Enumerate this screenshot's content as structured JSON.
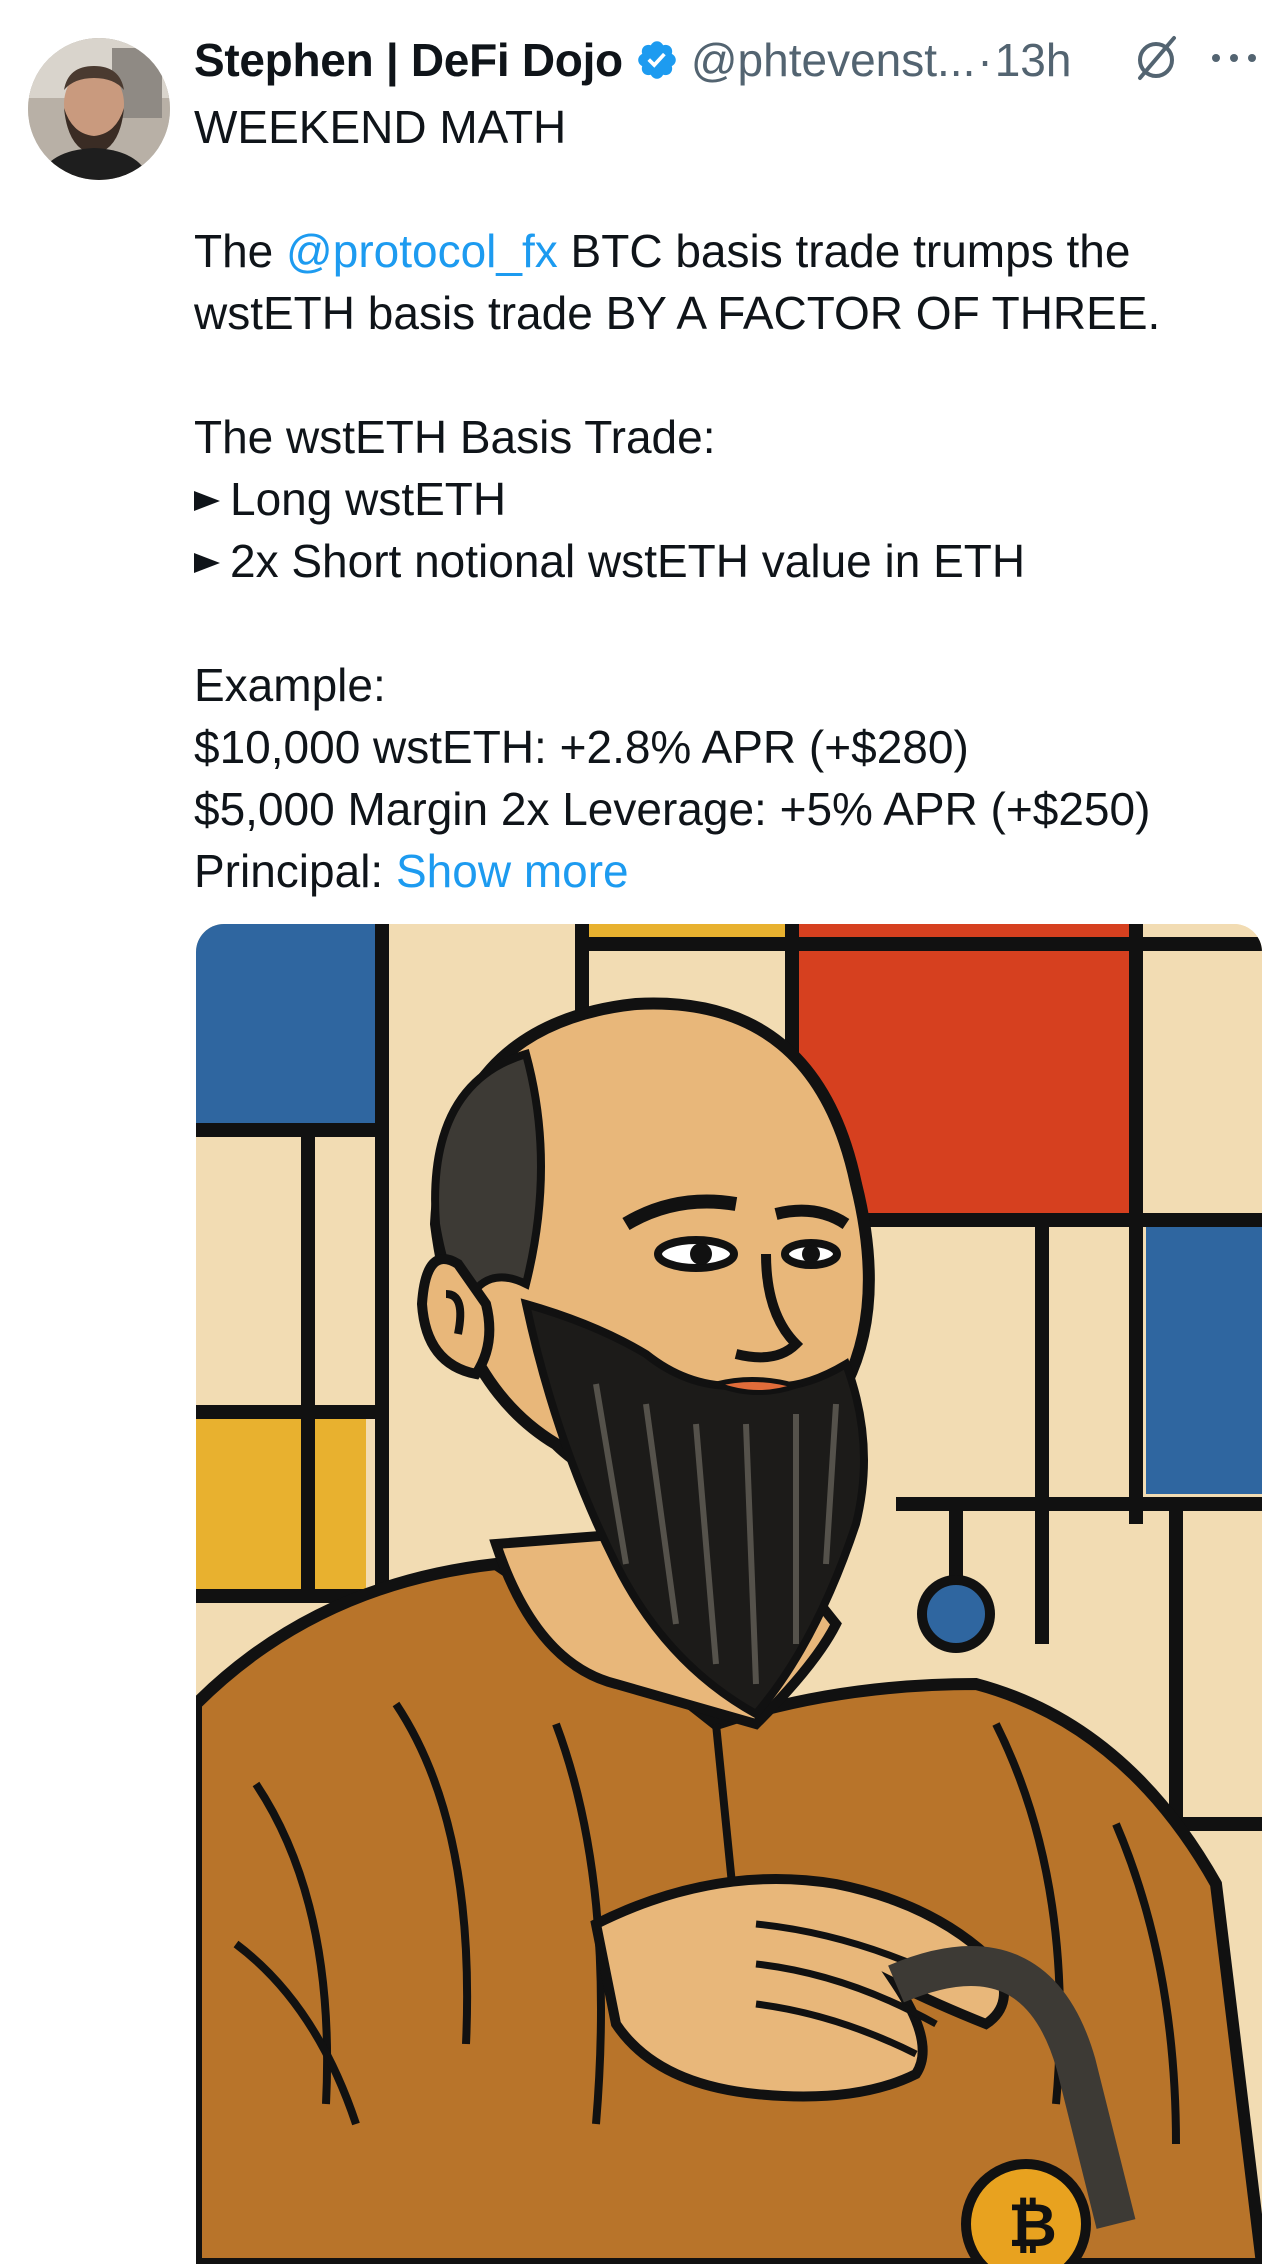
{
  "author": {
    "display_name": "Stephen | DeFi Dojo",
    "handle": "@phtevenst...",
    "separator": "·",
    "timestamp": "13h",
    "verified": true,
    "verified_color": "#1d9bf0"
  },
  "icons": {
    "verified": "verified-badge-icon",
    "grok": "grok-icon",
    "more": "more-horizontal-icon"
  },
  "tweet": {
    "line1": "WEEKEND MATH",
    "line2_prefix": "The ",
    "line2_mention": "@protocol_fx",
    "line2_suffix": " BTC basis trade trumps the",
    "line3": "wstETH basis trade BY A FACTOR OF THREE.",
    "line4": "The wstETH Basis Trade:",
    "bullet1": "Long wstETH",
    "bullet2": "2x Short notional wstETH value in ETH",
    "line5": "Example:",
    "line6": "$10,000 wstETH: +2.8% APR (+$280)",
    "line7": "$5,000 Margin 2x Leverage: +5% APR (+$250)",
    "line8_prefix": "Principal: ",
    "show_more": "Show more"
  },
  "colors": {
    "text": "#0f1419",
    "secondary": "#536471",
    "link": "#1d9bf0"
  }
}
